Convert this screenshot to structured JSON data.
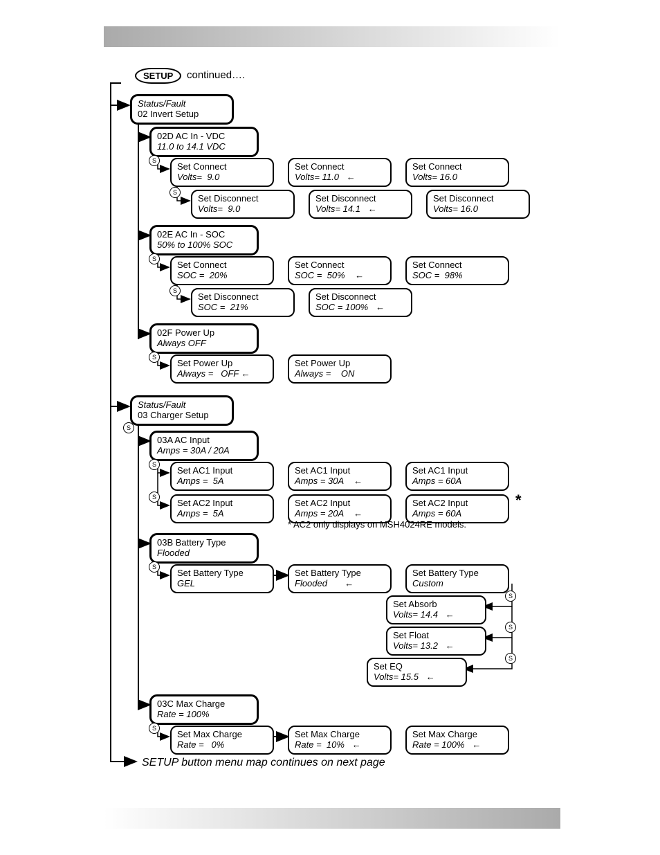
{
  "header": {
    "setup": "SETUP",
    "continued": "continued…."
  },
  "s02": {
    "title1": "Status/Fault",
    "title2": "02 Invert Setup",
    "d": {
      "head1": "02D AC In - VDC",
      "head2": "11.0 to 14.1 VDC",
      "cv": [
        {
          "l1": "Set Connect",
          "l2": "Volts=  9.0"
        },
        {
          "l1": "Set Connect",
          "l2": "Volts= 11.0   ←"
        },
        {
          "l1": "Set Connect",
          "l2": "Volts= 16.0"
        }
      ],
      "dv": [
        {
          "l1": "Set Disconnect",
          "l2": "Volts=  9.0"
        },
        {
          "l1": "Set Disconnect",
          "l2": "Volts= 14.1   ←"
        },
        {
          "l1": "Set Disconnect",
          "l2": "Volts= 16.0"
        }
      ]
    },
    "e": {
      "head1": "02E AC In - SOC",
      "head2": "50% to 100% SOC",
      "cs": [
        {
          "l1": "Set Connect",
          "l2": "SOC =  20%"
        },
        {
          "l1": "Set Connect",
          "l2": "SOC =  50%    ←"
        },
        {
          "l1": "Set Connect",
          "l2": "SOC =  98%"
        }
      ],
      "ds": [
        {
          "l1": "Set Disconnect",
          "l2": "SOC =  21%"
        },
        {
          "l1": "Set Disconnect",
          "l2": "SOC = 100%   ←"
        }
      ]
    },
    "f": {
      "head1": "02F Power Up",
      "head2": "Always OFF",
      "pu": [
        {
          "l1": "Set Power Up",
          "l2": "Always =   OFF ←"
        },
        {
          "l1": "Set Power Up",
          "l2": "Always =    ON"
        }
      ]
    }
  },
  "s03": {
    "title1": "Status/Fault",
    "title2": "03 Charger Setup",
    "a": {
      "head1": "03A AC Input",
      "head2": "Amps = 30A / 20A",
      "ac1": [
        {
          "l1": "Set AC1 Input",
          "l2": "Amps =  5A"
        },
        {
          "l1": "Set AC1 Input",
          "l2": "Amps = 30A    ←"
        },
        {
          "l1": "Set AC1 Input",
          "l2": "Amps = 60A"
        }
      ],
      "ac2": [
        {
          "l1": "Set AC2 Input",
          "l2": "Amps =  5A"
        },
        {
          "l1": "Set AC2 Input",
          "l2": "Amps = 20A    ←"
        },
        {
          "l1": "Set AC2 Input",
          "l2": "Amps = 60A"
        }
      ],
      "note": "* AC2 only displays on MSH4024RE models.",
      "star": "*"
    },
    "b": {
      "head1": "03B Battery Type",
      "head2": "Flooded",
      "bt": [
        {
          "l1": "Set Battery Type",
          "l2": "GEL"
        },
        {
          "l1": "Set Battery Type",
          "l2": "Flooded       ←"
        },
        {
          "l1": "Set Battery Type",
          "l2": "Custom"
        }
      ],
      "absorb": {
        "l1": "Set Absorb",
        "l2": "Volts= 14.4   ←"
      },
      "float": {
        "l1": "Set Float",
        "l2": "Volts= 13.2   ←"
      },
      "eq": {
        "l1": "Set EQ",
        "l2": "Volts= 15.5   ←"
      }
    },
    "c": {
      "head1": "03C Max Charge",
      "head2": "Rate = 100%",
      "mc": [
        {
          "l1": "Set Max Charge",
          "l2": "Rate =   0%"
        },
        {
          "l1": "Set Max Charge",
          "l2": "Rate =  10%   ←"
        },
        {
          "l1": "Set Max Charge",
          "l2": "Rate = 100%   ←"
        }
      ]
    }
  },
  "footer": "SETUP button menu map continues on next page"
}
